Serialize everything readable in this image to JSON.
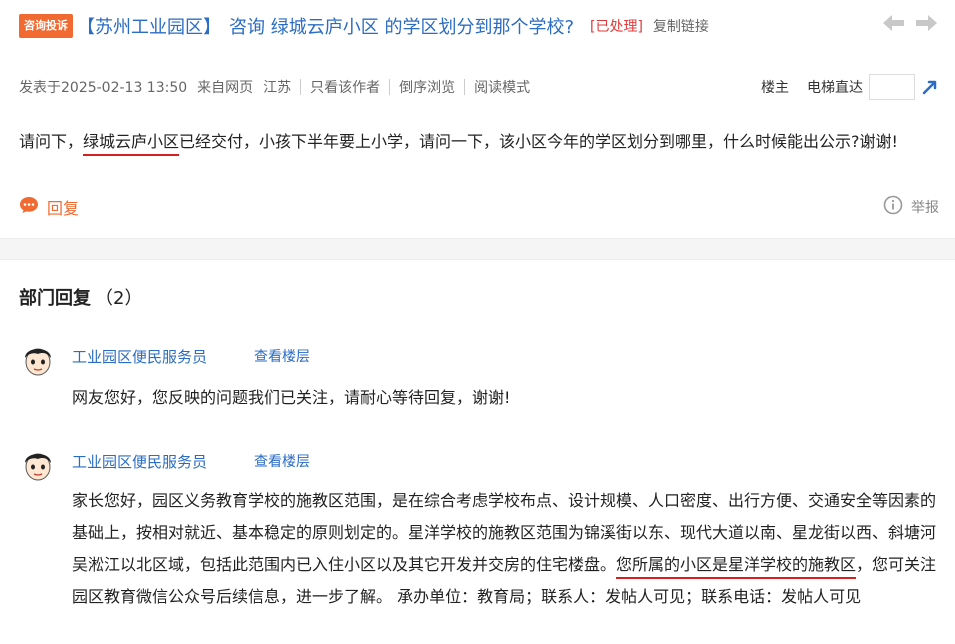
{
  "post": {
    "type_badge": "咨询投诉",
    "forum": "【苏州工业园区】",
    "title": "咨询 绿城云庐小区 的学区划分到那个学校?",
    "status": "[已处理]",
    "copy_link": "复制链接",
    "meta": {
      "posted": "发表于2025-02-13 13:50",
      "source": "来自网页",
      "region": "江苏",
      "author_only": "只看该作者",
      "reverse": "倒序浏览",
      "read_mode": "阅读模式",
      "floor_owner": "楼主",
      "elevator": "电梯直达"
    },
    "body_before": "请问下，",
    "body_highlight": "绿城云庐小区",
    "body_after": "已经交付，小孩下半年要上小学，请问一下，该小区今年的学区划分到哪里，什么时候能出公示?谢谢!",
    "reply_label": "回复",
    "report_label": "举报"
  },
  "replies_section": {
    "title": "部门回复",
    "count": "（2）"
  },
  "replies": [
    {
      "name": "工业园区便民服务员",
      "view_floor": "查看楼层",
      "text": "网友您好，您反映的问题我们已关注，请耐心等待回复，谢谢!"
    },
    {
      "name": "工业园区便民服务员",
      "view_floor": "查看楼层",
      "text_before": "家长您好，园区义务教育学校的施教区范围，是在综合考虑学校布点、设计规模、人口密度、出行方便、交通安全等因素的基础上，按相对就近、基本稳定的原则划定的。星洋学校的施教区范围为锦溪街以东、现代大道以南、星龙街以西、斜塘河吴淞江以北区域，包括此范围内已入住小区以及其它开发并交房的住宅楼盘。",
      "text_highlight": "您所属的小区是星洋学校的施教区",
      "text_after": "，您可关注园区教育微信公众号后续信息，进一步了解。 承办单位：教育局；联系人：发帖人可见；联系电话：发帖人可见"
    }
  ],
  "colors": {
    "link": "#2b6cc4",
    "badge": "#f06a32",
    "status": "#e03a3a",
    "underline": "#d42020"
  }
}
